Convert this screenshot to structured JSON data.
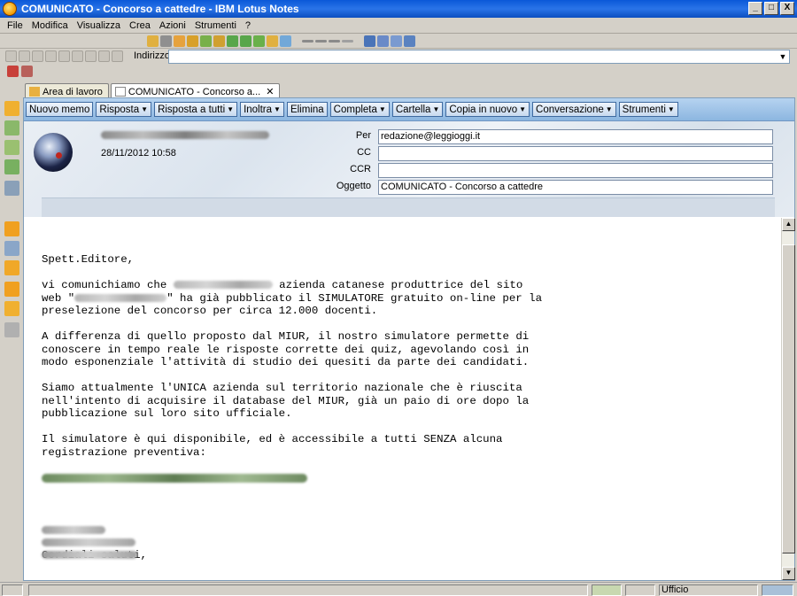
{
  "window": {
    "title": "COMUNICATO - Concorso a cattedre - IBM Lotus Notes",
    "minimize": "_",
    "maximize": "□",
    "close": "X"
  },
  "menu": [
    "File",
    "Modifica",
    "Visualizza",
    "Crea",
    "Azioni",
    "Strumenti",
    "?"
  ],
  "address": {
    "label": "Indirizzo",
    "value": ""
  },
  "tabs": [
    {
      "label": "Area di lavoro",
      "active": false
    },
    {
      "label": "COMUNICATO - Concorso a...",
      "active": true,
      "close": "✕"
    }
  ],
  "actions": [
    {
      "label": "Nuovo memo",
      "dropdown": false
    },
    {
      "label": "Risposta",
      "dropdown": true
    },
    {
      "label": "Risposta a tutti",
      "dropdown": true
    },
    {
      "label": "Inoltra",
      "dropdown": true
    },
    {
      "label": "Elimina",
      "dropdown": false
    },
    {
      "label": "Completa",
      "dropdown": true
    },
    {
      "label": "Cartella",
      "dropdown": true
    },
    {
      "label": "Copia in nuovo",
      "dropdown": true
    },
    {
      "label": "Conversazione",
      "dropdown": true
    },
    {
      "label": "Strumenti",
      "dropdown": true
    }
  ],
  "header": {
    "date": "28/11/2012 10:58",
    "fields": {
      "per": {
        "label": "Per",
        "value": "redazione@leggioggi.it"
      },
      "cc": {
        "label": "CC",
        "value": ""
      },
      "ccr": {
        "label": "CCR",
        "value": ""
      },
      "oggetto": {
        "label": "Oggetto",
        "value": "COMUNICATO - Concorso a cattedre"
      }
    }
  },
  "body": {
    "greeting": "Spett.Editore,",
    "p1_l1a": "vi comunichiamo che ",
    "p1_l1b": " azienda catanese produttrice del sito",
    "p1_l2a": "web \"",
    "p1_l2b": "\" ha già pubblicato il SIMULATORE gratuito on-line per la",
    "p1_l3": "preselezione del concorso per circa 12.000 docenti.",
    "p2": "A differenza di quello proposto dal MIUR, il nostro simulatore permette di\nconoscere in tempo reale le risposte corrette dei quiz, agevolando così in\nmodo esponenziale l'attività di studio dei quesiti da parte dei candidati.",
    "p3": "Siamo attualmente l'UNICA azienda sul territorio nazionale che è riuscita\nnell'intento di acquisire il database del MIUR, già un paio di ore dopo la\npubblicazione sul loro sito ufficiale.",
    "p4": "Il simulatore è qui disponibile, ed è accessibile a tutti SENZA alcuna\nregistrazione preventiva:",
    "closing": "Cordiali saluti,"
  },
  "status": {
    "location": "Ufficio"
  }
}
